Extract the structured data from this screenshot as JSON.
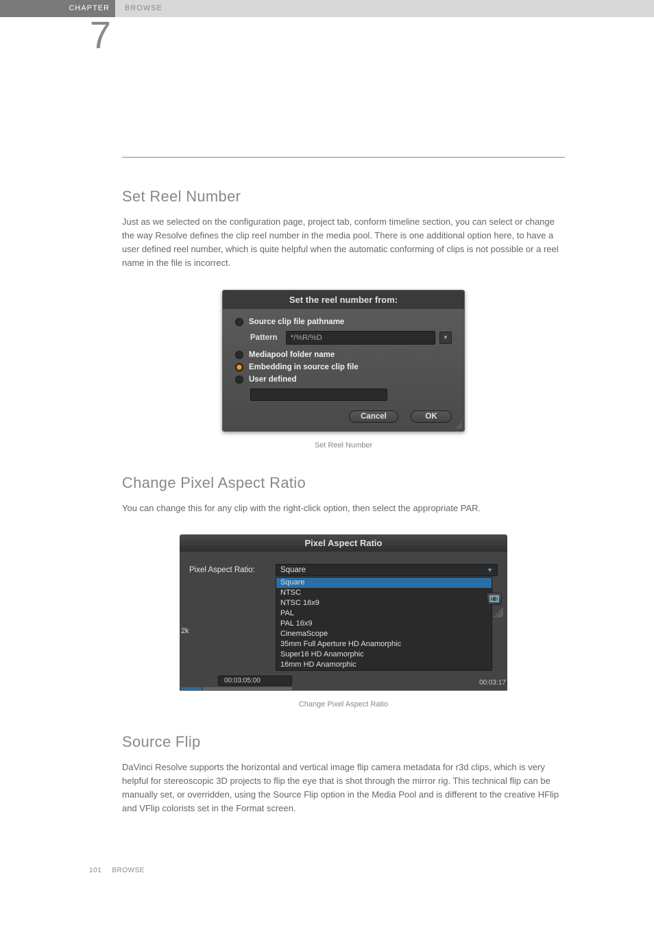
{
  "header": {
    "chapter_label": "CHAPTER",
    "browse_label": "BROWSE",
    "chapter_number": "7"
  },
  "sect1": {
    "title": "Set Reel Number",
    "body": "Just as we selected on the configuration page, project tab, conform timeline section, you can select or change the way Resolve defines the clip reel number in the media pool. There is one additional option here, to have a user defined reel number, which is quite helpful when the automatic conforming of clips is not possible or a reel name in the file is incorrect.",
    "caption": "Set Reel Number"
  },
  "dlg_reel": {
    "title": "Set the reel number from:",
    "opt1": "Source clip file pathname",
    "pattern_label": "Pattern",
    "pattern_value": "*/%R/%D",
    "opt2": "Mediapool folder name",
    "opt3": "Embedding in source clip file",
    "opt4": "User defined",
    "cancel": "Cancel",
    "ok": "OK"
  },
  "sect2": {
    "title": "Change Pixel Aspect Ratio",
    "body": "You can change this for any clip with the right-click option, then select the appropriate PAR.",
    "caption": "Change Pixel Aspect Ratio"
  },
  "dlg_par": {
    "title": "Pixel Aspect Ratio",
    "label": "Pixel Aspect Ratio:",
    "selected": "Square",
    "options": [
      "Square",
      "NTSC",
      "NTSC 16x9",
      "PAL",
      "PAL 16x9",
      "CinemaScope",
      "35mm Full Aperture HD Anamorphic",
      "Super16 HD Anamorphic",
      "16mm HD Anamorphic"
    ],
    "left_text": "2k",
    "tc_left": "00:03:05:00",
    "tc_right": "00:03:17"
  },
  "sect3": {
    "title": "Source Flip",
    "body": "DaVinci Resolve supports the horizontal and vertical image flip camera metadata for r3d clips, which is very helpful for stereoscopic 3D projects to flip the eye that is shot through the mirror rig. This technical flip can be manually set, or overridden, using the Source Flip option in the Media Pool and is different to the creative HFlip and VFlip colorists set in the Format screen."
  },
  "footer": {
    "page": "101",
    "section": "BROWSE"
  }
}
